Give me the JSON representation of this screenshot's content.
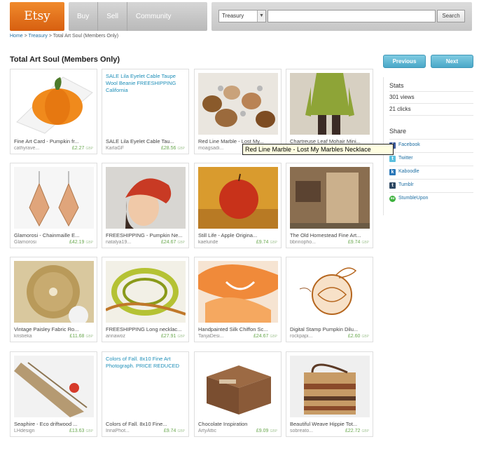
{
  "header": {
    "logo": "Etsy",
    "nav": [
      "Buy",
      "Sell",
      "Community"
    ],
    "search": {
      "category": "Treasury",
      "value": "",
      "button": "Search"
    }
  },
  "breadcrumb": {
    "home": "Home",
    "treasury": "Treasury",
    "current": "Total Art Soul (Members Only)"
  },
  "page": {
    "title": "Total Art Soul (Members Only)",
    "prev": "Previous",
    "next": "Next"
  },
  "stats": {
    "heading": "Stats",
    "views": "301 views",
    "clicks": "21 clicks"
  },
  "share": {
    "heading": "Share",
    "items": [
      {
        "label": "Facebook",
        "icon": "facebook-icon",
        "color": "#3b5998",
        "glyph": "f"
      },
      {
        "label": "Twitter",
        "icon": "twitter-icon",
        "color": "#5bc0de",
        "glyph": "t"
      },
      {
        "label": "Kaboodle",
        "icon": "kaboodle-icon",
        "color": "#2a77b8",
        "glyph": "k"
      },
      {
        "label": "Tumblr",
        "icon": "tumblr-icon",
        "color": "#2c4762",
        "glyph": "t"
      },
      {
        "label": "StumbleUpon",
        "icon": "stumbleupon-icon",
        "color": "#3db13d",
        "glyph": "su"
      }
    ]
  },
  "tooltip": "Red Line Marble - Lost My Marbles Necklace",
  "items": [
    {
      "title": "Fine Art Card - Pumpkin fr...",
      "shop": "cathyrave...",
      "price": "£2.27",
      "cur": "GBP",
      "img": "pumpkin"
    },
    {
      "title": "SALE Lila Eyelet Cable Tau...",
      "shop": "KarlaGF",
      "price": "£28.56",
      "cur": "GBP",
      "img": "",
      "text": "SALE Lila Eyelet Cable Taupe Wool Beanie FREESHIPPING California"
    },
    {
      "title": "Red Line Marble - Lost My...",
      "shop": "moagsadi...",
      "price": "",
      "cur": "",
      "img": "marbles"
    },
    {
      "title": "Chartreuse Leaf Mohair Mini...",
      "shop": "",
      "price": "",
      "cur": "",
      "img": "green-knit"
    },
    {
      "title": "Glamorosi - Chainmaille E...",
      "shop": "Glamorosi",
      "price": "£42.19",
      "cur": "GBP",
      "img": "earrings"
    },
    {
      "title": "FREESHIPPING - Pumpkin Ne...",
      "shop": "natalya19...",
      "price": "£24.67",
      "cur": "GBP",
      "img": "red-hat"
    },
    {
      "title": "Still Life - Apple Origina...",
      "shop": "kaelunde",
      "price": "£9.74",
      "cur": "GBP",
      "img": "apple"
    },
    {
      "title": "The Old Homestead Fine Art...",
      "shop": "bbnnopho...",
      "price": "£9.74",
      "cur": "GBP",
      "img": "homestead"
    },
    {
      "title": "Vintage Paisley Fabric Ro...",
      "shop": "kristieka",
      "price": "£11.68",
      "cur": "GBP",
      "img": "paisley"
    },
    {
      "title": "FREESHIPPING Long necklac...",
      "shop": "annawoz",
      "price": "£27.91",
      "cur": "GBP",
      "img": "green-necklace"
    },
    {
      "title": "Handpainted Silk Chiffon Sc...",
      "shop": "TanjaDesi...",
      "price": "£24.67",
      "cur": "GBP",
      "img": "orange-scarf"
    },
    {
      "title": "Digital Stamp Pumpkin Dilu...",
      "shop": "rockpapi...",
      "price": "£2.60",
      "cur": "GBP",
      "img": "pumpkin-stamp"
    },
    {
      "title": "Seaphire - Eco driftwood ...",
      "shop": "LHdesign",
      "price": "£13.63",
      "cur": "GBP",
      "img": "driftwood"
    },
    {
      "title": "Colors of Fall. 8x10 Fine...",
      "shop": "IrinaPhot...",
      "price": "£9.74",
      "cur": "GBP",
      "img": "",
      "text": "Colors of Fall. 8x10 Fine Art Photograph. PRICE REDUCED"
    },
    {
      "title": "Chocolate Inspiration",
      "shop": "ArtyAttic",
      "price": "£9.09",
      "cur": "GBP",
      "img": "choc-box"
    },
    {
      "title": "Beautiful Weave Hippie Tot...",
      "shop": "sobreato...",
      "price": "£22.72",
      "cur": "GBP",
      "img": "tote"
    }
  ]
}
